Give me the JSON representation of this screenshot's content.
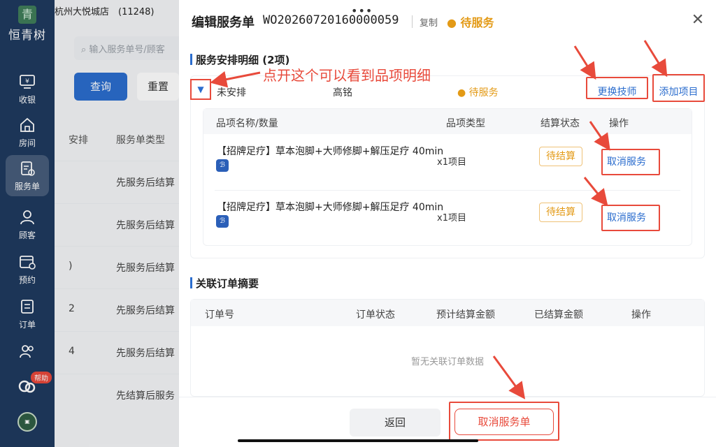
{
  "sidebar": {
    "logo_text": "恒青树",
    "logo_glyph": "青",
    "items": [
      {
        "label": "收银",
        "icon": "cashier-icon"
      },
      {
        "label": "房间",
        "icon": "room-icon"
      },
      {
        "label": "服务单",
        "icon": "service-order-icon",
        "active": true
      },
      {
        "label": "顾客",
        "icon": "customer-icon"
      },
      {
        "label": "预约",
        "icon": "calendar-icon"
      },
      {
        "label": "订单",
        "icon": "order-icon"
      },
      {
        "label": "",
        "icon": "staff-icon"
      }
    ],
    "help_badge": "帮助"
  },
  "background": {
    "store": "杭州大悦城店　(11248)",
    "search_placeholder": "输入服务单号/顾客",
    "query_button": "查询",
    "reset_button": "重置",
    "columns": [
      "安排",
      "服务单类型"
    ],
    "rows": [
      {
        "a": "",
        "type": "先服务后结算"
      },
      {
        "a": "",
        "type": "先服务后结算"
      },
      {
        "a": ")",
        "type": "先服务后结算"
      },
      {
        "a": "2",
        "type": "先服务后结算"
      },
      {
        "a": "4",
        "type": "先服务后结算"
      },
      {
        "a": "",
        "type": "先结算后服务"
      }
    ]
  },
  "panel": {
    "title": "编辑服务单",
    "order_no": "WO20260720160000059",
    "copy": "复制",
    "status": "● 待服务",
    "section1_title": "服务安排明细 (2项)",
    "arrange": {
      "toggle": "▼",
      "arrange_status": "未安排",
      "technician": "高铭",
      "service_status": "● 待服务",
      "change_tech": "更换技师",
      "add_item": "添加项目"
    },
    "item_table": {
      "headers": [
        "品项名称/数量",
        "品项类型",
        "结算状态",
        "操作"
      ],
      "rows": [
        {
          "name": "【招牌足疗】草本泡脚+大师修脚+解压足疗 40min",
          "qty": "x1项目",
          "settle": "待结算",
          "action": "取消服务"
        },
        {
          "name": "【招牌足疗】草本泡脚+大师修脚+解压足疗 40min",
          "qty": "x1项目",
          "settle": "待结算",
          "action": "取消服务"
        }
      ]
    },
    "section2_title": "关联订单摘要",
    "order_table": {
      "headers": [
        "订单号",
        "订单状态",
        "预计结算金额",
        "已结算金额",
        "操作"
      ],
      "empty": "暂无关联订单数据"
    },
    "footer": {
      "back": "返回",
      "cancel_order": "取消服务单"
    }
  },
  "annotation": "点开这个可以看到品项明细",
  "colors": {
    "accent": "#2b6dce",
    "sidebar": "#1f3a5f",
    "warning": "#e39a16",
    "annotation_red": "#e84a3b"
  }
}
